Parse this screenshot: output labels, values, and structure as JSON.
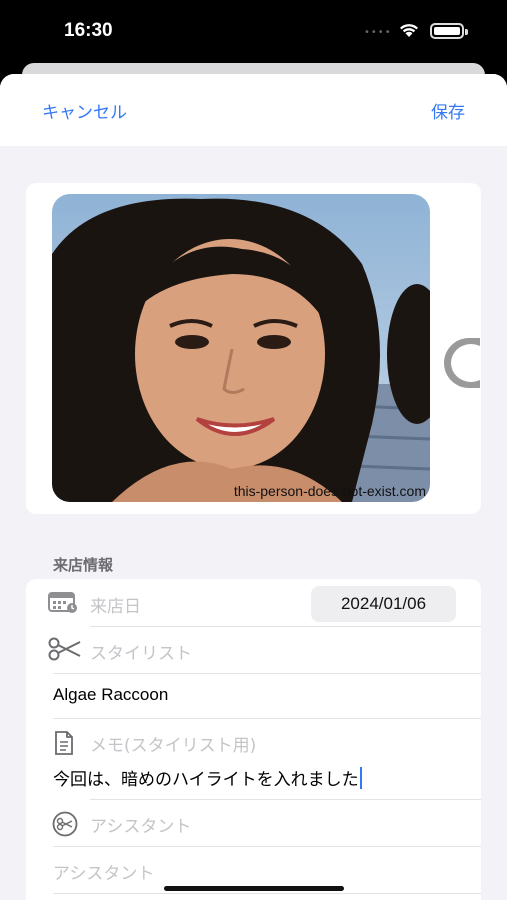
{
  "status_bar": {
    "time": "16:30",
    "dots": "••••"
  },
  "nav": {
    "cancel_label": "キャンセル",
    "save_label": "保存"
  },
  "photo": {
    "caption": "this-person-does-not-exist.com"
  },
  "section": {
    "visit_info_header": "来店情報"
  },
  "form": {
    "visit_date_label": "来店日",
    "visit_date_value": "2024/01/06",
    "stylist_label": "スタイリスト",
    "stylist_value": "Algae Raccoon",
    "memo_label": "メモ(スタイリスト用)",
    "memo_value": "今回は、暗めのハイライトを入れました",
    "assistant_label": "アシスタント",
    "assistant_placeholder": "アシスタント"
  },
  "colors": {
    "accent": "#3478f6",
    "background": "#f2f2f7",
    "placeholder": "#c5c5c9"
  },
  "icons": [
    "calendar-icon",
    "scissors-icon",
    "document-icon",
    "scissors-circle-icon",
    "wifi-icon",
    "battery-icon"
  ]
}
